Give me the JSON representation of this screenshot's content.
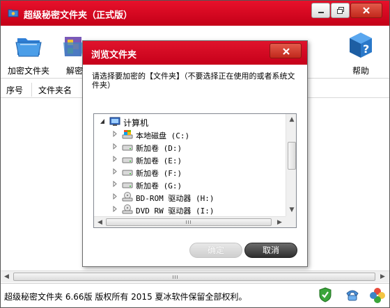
{
  "app": {
    "title": "超级秘密文件夹（正式版）"
  },
  "toolbar": {
    "encrypt_label": "加密文件夹",
    "decrypt_label": "解密",
    "help_label": "帮助"
  },
  "list": {
    "columns": [
      "序号",
      "文件夹名"
    ]
  },
  "status": {
    "text": "超级秘密文件夹 6.66版 版权所有 2015 夏冰软件保留全部权利。"
  },
  "dialog": {
    "title": "浏览文件夹",
    "instruction": "请选择要加密的【文件夹】（不要选择正在使用的或者系统文件夹）",
    "tree": {
      "root": "计算机",
      "items": [
        {
          "label": "本地磁盘 (C:)",
          "icon": "system-drive-icon"
        },
        {
          "label": "新加卷 (D:)",
          "icon": "drive-icon"
        },
        {
          "label": "新加卷 (E:)",
          "icon": "drive-icon"
        },
        {
          "label": "新加卷 (F:)",
          "icon": "drive-icon"
        },
        {
          "label": "新加卷 (G:)",
          "icon": "drive-icon"
        },
        {
          "label": "BD-ROM 驱动器 (H:)",
          "icon": "optical-drive-icon"
        },
        {
          "label": "DVD RW 驱动器 (I:)",
          "icon": "optical-drive-icon"
        }
      ]
    },
    "ok_label": "确定",
    "cancel_label": "取消"
  },
  "colors": {
    "title_red": "#d40a22",
    "button_dark": "#3a3a3a"
  }
}
